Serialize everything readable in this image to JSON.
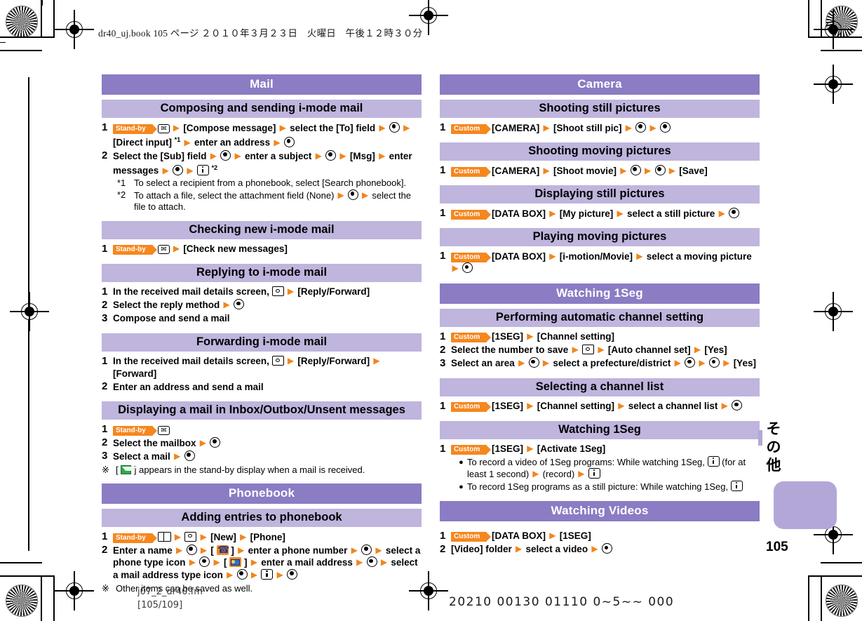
{
  "page_header": "dr40_uj.book   105 ページ   ２０１０年３月２３日　火曜日　午後１２時３０分",
  "footer": {
    "file": "j07_2_dr40.fm",
    "pages": "[105/109]",
    "code": "20210  00130  01110  0~5~~  000"
  },
  "side_tab": {
    "label_chars": [
      "そ",
      "の",
      "他"
    ],
    "page_number": "105"
  },
  "colors": {
    "bar_main": "#8b7cc4",
    "bar_sub": "#bfb5dd",
    "accent_orange": "#f5871f",
    "tab_purple": "#b3a7d8"
  },
  "tokens": {
    "standby": "Stand-by",
    "custom": "Custom"
  },
  "left_column": [
    {
      "type": "main",
      "title": "Mail"
    },
    {
      "type": "sub",
      "title": "Composing and sending i-mode mail",
      "steps": [
        {
          "num": "1",
          "parts": [
            {
              "t": "badge",
              "v": "Stand-by"
            },
            {
              "t": "key-mail"
            },
            {
              "t": "arrow"
            },
            {
              "t": "text",
              "v": "[Compose message]"
            },
            {
              "t": "arrow"
            },
            {
              "t": "text",
              "v": "select the [To] field"
            },
            {
              "t": "arrow"
            },
            {
              "t": "ok"
            },
            {
              "t": "arrow"
            },
            {
              "t": "text",
              "v": "[Direct input]"
            },
            {
              "t": "sup",
              "v": "*1"
            },
            {
              "t": "arrow"
            },
            {
              "t": "text",
              "v": "enter an address"
            },
            {
              "t": "arrow"
            },
            {
              "t": "ok"
            }
          ]
        },
        {
          "num": "2",
          "parts": [
            {
              "t": "text",
              "v": "Select the [Sub] field"
            },
            {
              "t": "arrow"
            },
            {
              "t": "ok"
            },
            {
              "t": "arrow"
            },
            {
              "t": "text",
              "v": "enter a subject"
            },
            {
              "t": "arrow"
            },
            {
              "t": "ok"
            },
            {
              "t": "arrow"
            },
            {
              "t": "text",
              "v": "[Msg]"
            },
            {
              "t": "arrow"
            },
            {
              "t": "text",
              "v": "enter messages"
            },
            {
              "t": "arrow"
            },
            {
              "t": "ok"
            },
            {
              "t": "arrow"
            },
            {
              "t": "ikey"
            },
            {
              "t": "sup",
              "v": "*2"
            }
          ]
        }
      ],
      "footnotes": [
        {
          "mark": "*1",
          "parts": [
            {
              "t": "text",
              "v": "To select a recipient from a phonebook, select [Search phonebook]."
            }
          ]
        },
        {
          "mark": "*2",
          "parts": [
            {
              "t": "text",
              "v": "To attach a file, select the attachment field (None)"
            },
            {
              "t": "arrow"
            },
            {
              "t": "ok"
            },
            {
              "t": "arrow"
            },
            {
              "t": "text",
              "v": "select the file to attach."
            }
          ]
        }
      ]
    },
    {
      "type": "sub",
      "title": "Checking new i-mode mail",
      "steps": [
        {
          "num": "1",
          "parts": [
            {
              "t": "badge",
              "v": "Stand-by"
            },
            {
              "t": "key-mail"
            },
            {
              "t": "arrow"
            },
            {
              "t": "text",
              "v": "[Check new messages]"
            }
          ]
        }
      ]
    },
    {
      "type": "sub",
      "title": "Replying to i-mode mail",
      "steps": [
        {
          "num": "1",
          "parts": [
            {
              "t": "text",
              "v": "In the received mail details screen,"
            },
            {
              "t": "cam"
            },
            {
              "t": "arrow"
            },
            {
              "t": "text",
              "v": "[Reply/Forward]"
            }
          ]
        },
        {
          "num": "2",
          "parts": [
            {
              "t": "text",
              "v": "Select the reply method"
            },
            {
              "t": "arrow"
            },
            {
              "t": "ok"
            }
          ]
        },
        {
          "num": "3",
          "parts": [
            {
              "t": "text",
              "v": "Compose and send a mail"
            }
          ]
        }
      ]
    },
    {
      "type": "sub",
      "title": "Forwarding i-mode mail",
      "steps": [
        {
          "num": "1",
          "parts": [
            {
              "t": "text",
              "v": "In the received mail details screen,"
            },
            {
              "t": "cam"
            },
            {
              "t": "arrow"
            },
            {
              "t": "text",
              "v": "[Reply/Forward]"
            },
            {
              "t": "arrow"
            },
            {
              "t": "text",
              "v": "[Forward]"
            }
          ]
        },
        {
          "num": "2",
          "parts": [
            {
              "t": "text",
              "v": "Enter an address and send a mail"
            }
          ]
        }
      ]
    },
    {
      "type": "sub",
      "title": "Displaying a mail in Inbox/Outbox/Unsent messages",
      "steps": [
        {
          "num": "1",
          "parts": [
            {
              "t": "badge",
              "v": "Stand-by"
            },
            {
              "t": "key-mail"
            }
          ]
        },
        {
          "num": "2",
          "parts": [
            {
              "t": "text",
              "v": "Select the mailbox"
            },
            {
              "t": "arrow"
            },
            {
              "t": "ok"
            }
          ]
        },
        {
          "num": "3",
          "parts": [
            {
              "t": "text",
              "v": "Select a mail"
            },
            {
              "t": "arrow"
            },
            {
              "t": "ok"
            }
          ]
        }
      ],
      "notes": [
        {
          "mark": "※",
          "parts": [
            {
              "t": "text",
              "v": "["
            },
            {
              "t": "newmail"
            },
            {
              "t": "text",
              "v": "] appears in the stand-by display when a mail is received."
            }
          ]
        }
      ]
    },
    {
      "type": "main",
      "title": "Phonebook"
    },
    {
      "type": "sub",
      "title": "Adding entries to phonebook",
      "steps": [
        {
          "num": "1",
          "parts": [
            {
              "t": "badge",
              "v": "Stand-by"
            },
            {
              "t": "pbkey"
            },
            {
              "t": "arrow"
            },
            {
              "t": "cam"
            },
            {
              "t": "arrow"
            },
            {
              "t": "text",
              "v": "[New]"
            },
            {
              "t": "arrow"
            },
            {
              "t": "text",
              "v": "[Phone]"
            }
          ]
        },
        {
          "num": "2",
          "parts": [
            {
              "t": "text",
              "v": "Enter a name"
            },
            {
              "t": "arrow"
            },
            {
              "t": "ok"
            },
            {
              "t": "arrow"
            },
            {
              "t": "text",
              "v": "["
            },
            {
              "t": "icphone"
            },
            {
              "t": "text",
              "v": "]"
            },
            {
              "t": "arrow"
            },
            {
              "t": "text",
              "v": "enter a phone number"
            },
            {
              "t": "arrow"
            },
            {
              "t": "ok"
            },
            {
              "t": "arrow"
            },
            {
              "t": "text",
              "v": "select a phone type icon"
            },
            {
              "t": "arrow"
            },
            {
              "t": "ok"
            },
            {
              "t": "arrow"
            },
            {
              "t": "text",
              "v": "["
            },
            {
              "t": "icmailaddr"
            },
            {
              "t": "text",
              "v": "]"
            },
            {
              "t": "arrow"
            },
            {
              "t": "text",
              "v": "enter a mail address"
            },
            {
              "t": "arrow"
            },
            {
              "t": "ok"
            },
            {
              "t": "arrow"
            },
            {
              "t": "text",
              "v": "select a mail address type icon"
            },
            {
              "t": "arrow"
            },
            {
              "t": "ok"
            },
            {
              "t": "arrow"
            },
            {
              "t": "ikey"
            },
            {
              "t": "arrow"
            },
            {
              "t": "ok"
            }
          ]
        }
      ],
      "notes": [
        {
          "mark": "※",
          "parts": [
            {
              "t": "text",
              "v": "Other items can be saved as well."
            }
          ]
        }
      ]
    }
  ],
  "right_column": [
    {
      "type": "main",
      "title": "Camera"
    },
    {
      "type": "sub",
      "title": "Shooting still pictures",
      "steps": [
        {
          "num": "1",
          "parts": [
            {
              "t": "badge",
              "v": "Custom"
            },
            {
              "t": "text",
              "v": "[CAMERA]"
            },
            {
              "t": "arrow"
            },
            {
              "t": "text",
              "v": "[Shoot still pic]"
            },
            {
              "t": "arrow"
            },
            {
              "t": "ok"
            },
            {
              "t": "arrow"
            },
            {
              "t": "ok"
            }
          ]
        }
      ]
    },
    {
      "type": "sub",
      "title": "Shooting moving pictures",
      "steps": [
        {
          "num": "1",
          "parts": [
            {
              "t": "badge",
              "v": "Custom"
            },
            {
              "t": "text",
              "v": "[CAMERA]"
            },
            {
              "t": "arrow"
            },
            {
              "t": "text",
              "v": "[Shoot movie]"
            },
            {
              "t": "arrow"
            },
            {
              "t": "ok"
            },
            {
              "t": "arrow"
            },
            {
              "t": "ok"
            },
            {
              "t": "arrow"
            },
            {
              "t": "text",
              "v": "[Save]"
            }
          ]
        }
      ]
    },
    {
      "type": "sub",
      "title": "Displaying still pictures",
      "steps": [
        {
          "num": "1",
          "parts": [
            {
              "t": "badge",
              "v": "Custom"
            },
            {
              "t": "text",
              "v": "[DATA BOX]"
            },
            {
              "t": "arrow"
            },
            {
              "t": "text",
              "v": "[My picture]"
            },
            {
              "t": "arrow"
            },
            {
              "t": "text",
              "v": "select a still picture"
            },
            {
              "t": "arrow"
            },
            {
              "t": "ok"
            }
          ]
        }
      ]
    },
    {
      "type": "sub",
      "title": "Playing moving pictures",
      "steps": [
        {
          "num": "1",
          "parts": [
            {
              "t": "badge",
              "v": "Custom"
            },
            {
              "t": "text",
              "v": "[DATA BOX]"
            },
            {
              "t": "arrow"
            },
            {
              "t": "text",
              "v": "[i-motion/Movie]"
            },
            {
              "t": "arrow"
            },
            {
              "t": "text",
              "v": "select a moving picture"
            },
            {
              "t": "arrow"
            },
            {
              "t": "ok"
            }
          ]
        }
      ]
    },
    {
      "type": "main",
      "title": "Watching 1Seg"
    },
    {
      "type": "sub",
      "title": "Performing automatic channel setting",
      "steps": [
        {
          "num": "1",
          "parts": [
            {
              "t": "badge",
              "v": "Custom"
            },
            {
              "t": "text",
              "v": "[1SEG]"
            },
            {
              "t": "arrow"
            },
            {
              "t": "text",
              "v": "[Channel setting]"
            }
          ]
        },
        {
          "num": "2",
          "parts": [
            {
              "t": "text",
              "v": "Select the number to save"
            },
            {
              "t": "arrow"
            },
            {
              "t": "cam"
            },
            {
              "t": "arrow"
            },
            {
              "t": "text",
              "v": "[Auto channel set]"
            },
            {
              "t": "arrow"
            },
            {
              "t": "text",
              "v": "[Yes]"
            }
          ]
        },
        {
          "num": "3",
          "parts": [
            {
              "t": "text",
              "v": "Select an area"
            },
            {
              "t": "arrow"
            },
            {
              "t": "ok"
            },
            {
              "t": "arrow"
            },
            {
              "t": "text",
              "v": "select a prefecture/district"
            },
            {
              "t": "arrow"
            },
            {
              "t": "ok"
            },
            {
              "t": "arrow"
            },
            {
              "t": "ok"
            },
            {
              "t": "arrow"
            },
            {
              "t": "text",
              "v": "[Yes]"
            }
          ]
        }
      ]
    },
    {
      "type": "sub",
      "title": "Selecting a channel list",
      "steps": [
        {
          "num": "1",
          "parts": [
            {
              "t": "badge",
              "v": "Custom"
            },
            {
              "t": "text",
              "v": "[1SEG]"
            },
            {
              "t": "arrow"
            },
            {
              "t": "text",
              "v": "[Channel setting]"
            },
            {
              "t": "arrow"
            },
            {
              "t": "text",
              "v": "select a channel list"
            },
            {
              "t": "arrow"
            },
            {
              "t": "ok"
            }
          ]
        }
      ]
    },
    {
      "type": "sub",
      "title": "Watching 1Seg",
      "steps": [
        {
          "num": "1",
          "parts": [
            {
              "t": "badge",
              "v": "Custom"
            },
            {
              "t": "text",
              "v": "[1SEG]"
            },
            {
              "t": "arrow"
            },
            {
              "t": "text",
              "v": "[Activate 1Seg]"
            }
          ]
        }
      ],
      "bullets": [
        {
          "parts": [
            {
              "t": "text",
              "v": "To record a video of 1Seg programs: While watching 1Seg,"
            },
            {
              "t": "ikey"
            },
            {
              "t": "text",
              "v": "(for at least 1 second)"
            },
            {
              "t": "arrow"
            },
            {
              "t": "text",
              "v": "(record)"
            },
            {
              "t": "arrow"
            },
            {
              "t": "ikey"
            }
          ]
        },
        {
          "parts": [
            {
              "t": "text",
              "v": "To record 1Seg programs as a still picture: While watching 1Seg,"
            },
            {
              "t": "ikey"
            }
          ]
        }
      ]
    },
    {
      "type": "main",
      "title": "Watching Videos"
    },
    {
      "type": "steps_only",
      "steps": [
        {
          "num": "1",
          "parts": [
            {
              "t": "badge",
              "v": "Custom"
            },
            {
              "t": "text",
              "v": "[DATA BOX]"
            },
            {
              "t": "arrow"
            },
            {
              "t": "text",
              "v": "[1SEG]"
            }
          ]
        },
        {
          "num": "2",
          "parts": [
            {
              "t": "text",
              "v": "[Video] folder"
            },
            {
              "t": "arrow"
            },
            {
              "t": "text",
              "v": "select a video"
            },
            {
              "t": "arrow"
            },
            {
              "t": "ok"
            }
          ]
        }
      ]
    }
  ]
}
